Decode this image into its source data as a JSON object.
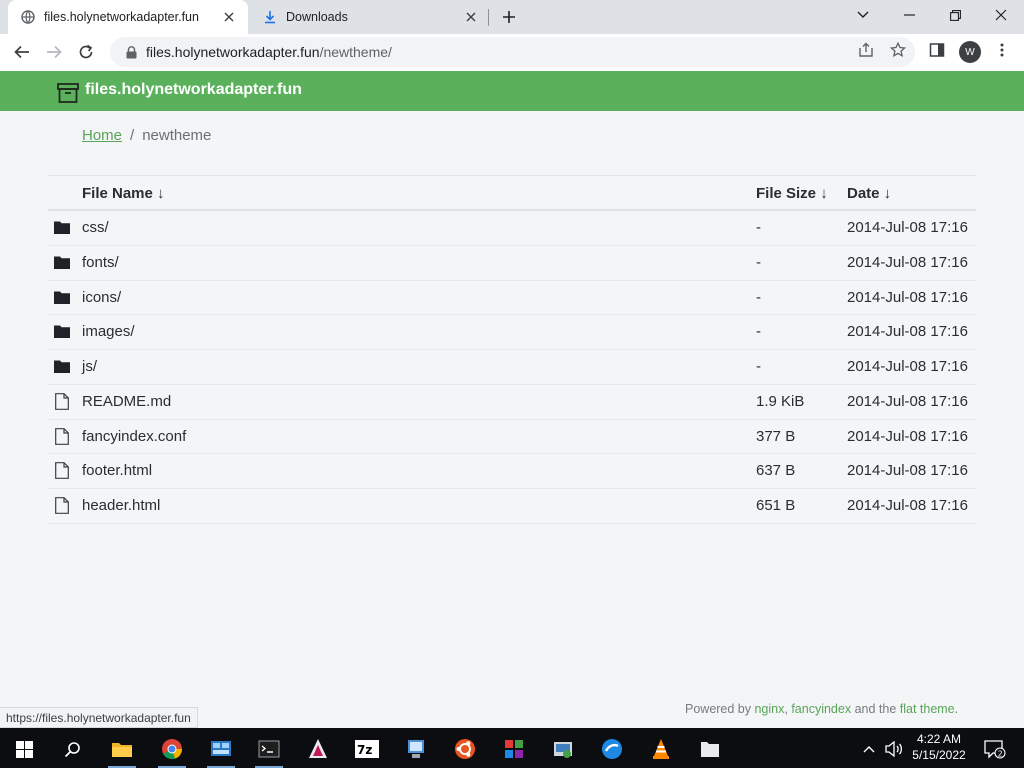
{
  "browser": {
    "tabs": [
      {
        "title": "files.holynetworkadapter.fun",
        "favicon": "globe-icon",
        "active": true
      },
      {
        "title": "Downloads",
        "favicon": "download-icon",
        "active": false
      }
    ],
    "url_host": "files.holynetworkadapter.fun",
    "url_path": "/newtheme/",
    "profile_initial": "W",
    "status_url": "https://files.holynetworkadapter.fun"
  },
  "site": {
    "title": "files.holynetworkadapter.fun",
    "accent": "#5bb15b"
  },
  "breadcrumb": {
    "home": "Home",
    "separator": "/",
    "current": "newtheme"
  },
  "listing": {
    "headers": {
      "name": "File Name  ↓",
      "size": "File Size  ↓",
      "date": "Date  ↓"
    },
    "rows": [
      {
        "type": "folder",
        "name": "css/",
        "size": "-",
        "date": "2014-Jul-08 17:16"
      },
      {
        "type": "folder",
        "name": "fonts/",
        "size": "-",
        "date": "2014-Jul-08 17:16"
      },
      {
        "type": "folder",
        "name": "icons/",
        "size": "-",
        "date": "2014-Jul-08 17:16"
      },
      {
        "type": "folder",
        "name": "images/",
        "size": "-",
        "date": "2014-Jul-08 17:16"
      },
      {
        "type": "folder",
        "name": "js/",
        "size": "-",
        "date": "2014-Jul-08 17:16"
      },
      {
        "type": "file",
        "name": "README.md",
        "size": "1.9 KiB",
        "date": "2014-Jul-08 17:16"
      },
      {
        "type": "file",
        "name": "fancyindex.conf",
        "size": "377 B",
        "date": "2014-Jul-08 17:16"
      },
      {
        "type": "file",
        "name": "footer.html",
        "size": "637 B",
        "date": "2014-Jul-08 17:16"
      },
      {
        "type": "file",
        "name": "header.html",
        "size": "651 B",
        "date": "2014-Jul-08 17:16"
      }
    ]
  },
  "footer": {
    "prefix": "Powered by ",
    "link1": "nginx",
    "comma": ", ",
    "link2": "fancyindex",
    "middle": " and the ",
    "link3": "flat theme",
    "suffix": "."
  },
  "taskbar": {
    "time": "4:22 AM",
    "date": "5/15/2022",
    "notification_count": "2"
  }
}
